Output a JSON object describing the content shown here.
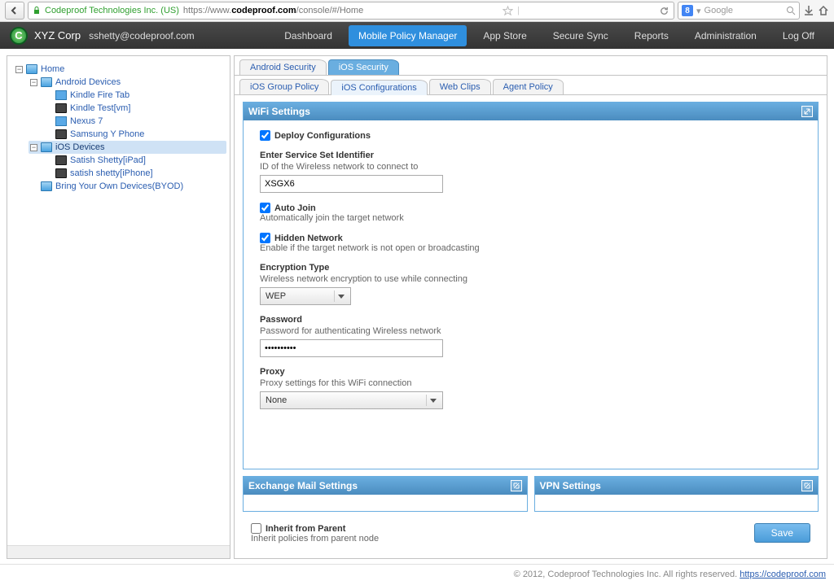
{
  "browser": {
    "site_name": "Codeproof Technologies Inc. (US)",
    "url_prefix": "https://www.",
    "url_domain": "codeproof.com",
    "url_path": "/console/#/Home",
    "search_engine_letter": "8",
    "search_placeholder": "Google"
  },
  "header": {
    "logo_letter": "C",
    "company": "XYZ Corp",
    "user_email": "sshetty@codeproof.com",
    "nav": [
      "Dashboard",
      "Mobile Policy Manager",
      "App Store",
      "Secure Sync",
      "Reports",
      "Administration",
      "Log Off"
    ],
    "active_nav_index": 1
  },
  "tree": {
    "root": "Home",
    "nodes": [
      {
        "label": "Android Devices",
        "children": [
          {
            "label": "Kindle Fire Tab",
            "icon": "kindle"
          },
          {
            "label": "Kindle Test[vm]",
            "icon": "phone"
          },
          {
            "label": "Nexus 7",
            "icon": "kindle"
          },
          {
            "label": "Samsung Y Phone",
            "icon": "phone"
          }
        ]
      },
      {
        "label": "iOS Devices",
        "selected": true,
        "children": [
          {
            "label": "Satish Shetty[iPad]",
            "icon": "phone"
          },
          {
            "label": "satish shetty[iPhone]",
            "icon": "phone"
          }
        ]
      },
      {
        "label": "Bring Your Own Devices(BYOD)",
        "children": []
      }
    ]
  },
  "tabs_top": [
    "Android Security",
    "iOS Security"
  ],
  "tabs_top_active": 1,
  "tabs_sub": [
    "iOS Group Policy",
    "iOS Configurations",
    "Web Clips",
    "Agent Policy"
  ],
  "tabs_sub_active": 1,
  "panel_main": {
    "title": "WiFi Settings",
    "deploy_label": "Deploy Configurations",
    "deploy_checked": true,
    "ssid_label": "Enter Service Set Identifier",
    "ssid_desc": "ID of the Wireless network to connect to",
    "ssid_value": "XSGX6",
    "autojoin_label": "Auto Join",
    "autojoin_desc": "Automatically join the target network",
    "autojoin_checked": true,
    "hidden_label": "Hidden Network",
    "hidden_desc": "Enable if the target network is not open or broadcasting",
    "hidden_checked": true,
    "enc_label": "Encryption Type",
    "enc_desc": "Wireless network encryption to use while connecting",
    "enc_value": "WEP",
    "pass_label": "Password",
    "pass_desc": "Password for authenticating Wireless network",
    "pass_value": "••••••••••",
    "proxy_label": "Proxy",
    "proxy_desc": "Proxy settings for this WiFi connection",
    "proxy_value": "None"
  },
  "panel_small": {
    "exchange_title": "Exchange Mail Settings",
    "vpn_title": "VPN Settings"
  },
  "bottom": {
    "inherit_label": "Inherit from Parent",
    "inherit_desc": "Inherit policies from parent node",
    "inherit_checked": false,
    "save_label": "Save"
  },
  "footer": {
    "copyright": "© 2012, Codeproof Technologies Inc. All rights reserved. ",
    "link_text": "https://codeproof.com"
  }
}
